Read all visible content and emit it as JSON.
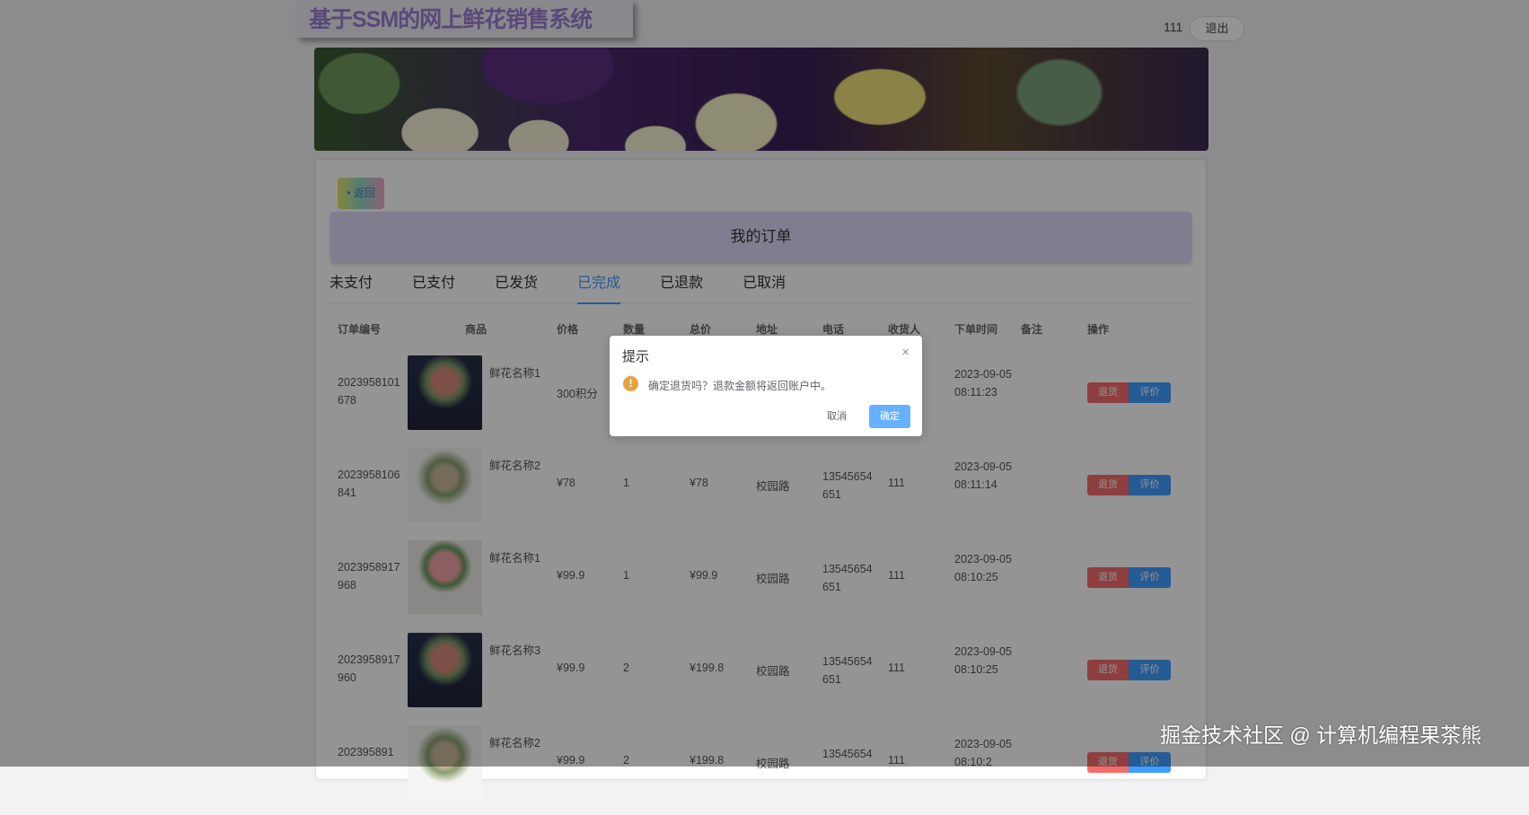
{
  "app_title": "基于SSM的网上鲜花销售系统",
  "user": {
    "name": "111",
    "logout": "退出"
  },
  "back_label": "返回",
  "page_title": "我的订单",
  "tabs": [
    "未支付",
    "已支付",
    "已发货",
    "已完成",
    "已退款",
    "已取消"
  ],
  "active_tab": "已完成",
  "columns": [
    "订单编号",
    "商品",
    "价格",
    "数量",
    "总价",
    "地址",
    "电话",
    "收货人",
    "下单时间",
    "备注",
    "操作"
  ],
  "rows": [
    {
      "id": "2023958101678",
      "name": "鲜花名称1",
      "price": "300积分",
      "qty": "",
      "total": "",
      "addr": "",
      "phone": "",
      "receiver": "",
      "time": "2023-09-05 08:11:23",
      "return": "退货",
      "review": "评价"
    },
    {
      "id": "2023958106841",
      "name": "鲜花名称2",
      "price": "¥78",
      "qty": "1",
      "total": "¥78",
      "addr": "校园路",
      "phone": "13545654651",
      "receiver": "111",
      "time": "2023-09-05 08:11:14",
      "return": "退货",
      "review": "评价"
    },
    {
      "id": "2023958917968",
      "name": "鲜花名称1",
      "price": "¥99.9",
      "qty": "1",
      "total": "¥99.9",
      "addr": "校园路",
      "phone": "13545654651",
      "receiver": "111",
      "time": "2023-09-05 08:10:25",
      "return": "退货",
      "review": "评价"
    },
    {
      "id": "2023958917960",
      "name": "鲜花名称3",
      "price": "¥99.9",
      "qty": "2",
      "total": "¥199.8",
      "addr": "校园路",
      "phone": "13545654651",
      "receiver": "111",
      "time": "2023-09-05 08:10:25",
      "return": "退货",
      "review": "评价"
    },
    {
      "id": "202395891",
      "name": "鲜花名称2",
      "price": "¥99.9",
      "qty": "2",
      "total": "¥199.8",
      "addr": "校园路",
      "phone": "13545654",
      "receiver": "111",
      "time": "2023-09-05 08:10:2",
      "return": "退货",
      "review": "评价"
    }
  ],
  "dialog": {
    "title": "提示",
    "close": "×",
    "icon": "!",
    "message": "确定退货吗？退款金额将返回账户中。",
    "cancel": "取消",
    "confirm": "确定"
  },
  "watermark": "掘金技术社区 @ 计算机编程果茶熊"
}
